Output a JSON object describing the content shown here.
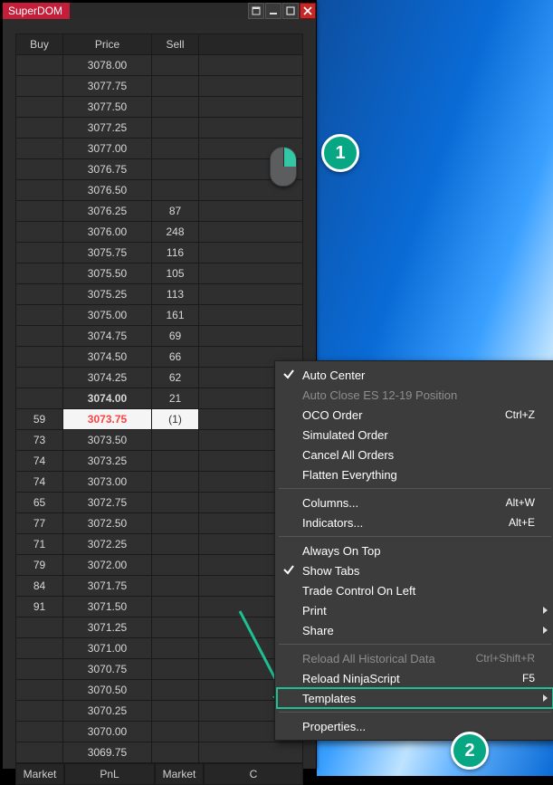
{
  "window": {
    "title": "SuperDOM"
  },
  "columns": {
    "buy": "Buy",
    "price": "Price",
    "sell": "Sell"
  },
  "footer": {
    "buy": "Market",
    "price": "PnL",
    "sell": "Market",
    "extra": "C"
  },
  "rows": [
    {
      "buy": "",
      "price": "3078.00",
      "sell": "",
      "kind": "plain"
    },
    {
      "buy": "",
      "price": "3077.75",
      "sell": "",
      "kind": "plain"
    },
    {
      "buy": "",
      "price": "3077.50",
      "sell": "",
      "kind": "plain"
    },
    {
      "buy": "",
      "price": "3077.25",
      "sell": "",
      "kind": "plain"
    },
    {
      "buy": "",
      "price": "3077.00",
      "sell": "",
      "kind": "plain"
    },
    {
      "buy": "",
      "price": "3076.75",
      "sell": "",
      "kind": "plain"
    },
    {
      "buy": "",
      "price": "3076.50",
      "sell": "",
      "kind": "plain"
    },
    {
      "buy": "",
      "price": "3076.25",
      "sell": "87",
      "kind": "plain"
    },
    {
      "buy": "",
      "price": "3076.00",
      "sell": "248",
      "kind": "plain"
    },
    {
      "buy": "",
      "price": "3075.75",
      "sell": "116",
      "kind": "plain"
    },
    {
      "buy": "",
      "price": "3075.50",
      "sell": "105",
      "kind": "plain"
    },
    {
      "buy": "",
      "price": "3075.25",
      "sell": "113",
      "kind": "plain"
    },
    {
      "buy": "",
      "price": "3075.00",
      "sell": "161",
      "kind": "plain"
    },
    {
      "buy": "",
      "price": "3074.75",
      "sell": "69",
      "kind": "plain"
    },
    {
      "buy": "",
      "price": "3074.50",
      "sell": "66",
      "kind": "plain"
    },
    {
      "buy": "",
      "price": "3074.25",
      "sell": "62",
      "kind": "plain"
    },
    {
      "buy": "",
      "price": "3074.00",
      "sell": "21",
      "kind": "ask"
    },
    {
      "buy": "59",
      "price": "3073.75",
      "sell": "(1)",
      "kind": "bid"
    },
    {
      "buy": "73",
      "price": "3073.50",
      "sell": "",
      "kind": "plain"
    },
    {
      "buy": "74",
      "price": "3073.25",
      "sell": "",
      "kind": "plain"
    },
    {
      "buy": "74",
      "price": "3073.00",
      "sell": "",
      "kind": "plain"
    },
    {
      "buy": "65",
      "price": "3072.75",
      "sell": "",
      "kind": "plain"
    },
    {
      "buy": "77",
      "price": "3072.50",
      "sell": "",
      "kind": "plain"
    },
    {
      "buy": "71",
      "price": "3072.25",
      "sell": "",
      "kind": "plain"
    },
    {
      "buy": "79",
      "price": "3072.00",
      "sell": "",
      "kind": "plain"
    },
    {
      "buy": "84",
      "price": "3071.75",
      "sell": "",
      "kind": "plain"
    },
    {
      "buy": "91",
      "price": "3071.50",
      "sell": "",
      "kind": "plain"
    },
    {
      "buy": "",
      "price": "3071.25",
      "sell": "",
      "kind": "plain"
    },
    {
      "buy": "",
      "price": "3071.00",
      "sell": "",
      "kind": "plain"
    },
    {
      "buy": "",
      "price": "3070.75",
      "sell": "",
      "kind": "plain"
    },
    {
      "buy": "",
      "price": "3070.50",
      "sell": "",
      "kind": "plain"
    },
    {
      "buy": "",
      "price": "3070.25",
      "sell": "",
      "kind": "plain"
    },
    {
      "buy": "",
      "price": "3070.00",
      "sell": "",
      "kind": "plain"
    },
    {
      "buy": "",
      "price": "3069.75",
      "sell": "",
      "kind": "plain"
    }
  ],
  "contextMenu": [
    {
      "label": "Auto Center",
      "checked": true
    },
    {
      "label": "Auto Close ES 12-19 Position",
      "disabled": true
    },
    {
      "label": "OCO Order",
      "shortcut": "Ctrl+Z"
    },
    {
      "label": "Simulated Order"
    },
    {
      "label": "Cancel All Orders"
    },
    {
      "label": "Flatten Everything"
    },
    {
      "sep": true
    },
    {
      "label": "Columns...",
      "shortcut": "Alt+W"
    },
    {
      "label": "Indicators...",
      "shortcut": "Alt+E"
    },
    {
      "sep": true
    },
    {
      "label": "Always On Top"
    },
    {
      "label": "Show Tabs",
      "checked": true
    },
    {
      "label": "Trade Control On Left"
    },
    {
      "label": "Print",
      "submenu": true
    },
    {
      "label": "Share",
      "submenu": true
    },
    {
      "sep": true
    },
    {
      "label": "Reload All Historical Data",
      "shortcut": "Ctrl+Shift+R",
      "disabled": true
    },
    {
      "label": "Reload NinjaScript",
      "shortcut": "F5"
    },
    {
      "label": "Templates",
      "submenu": true,
      "highlight": true
    },
    {
      "sep": true
    },
    {
      "label": "Properties..."
    }
  ],
  "badges": {
    "one": "1",
    "two": "2"
  }
}
